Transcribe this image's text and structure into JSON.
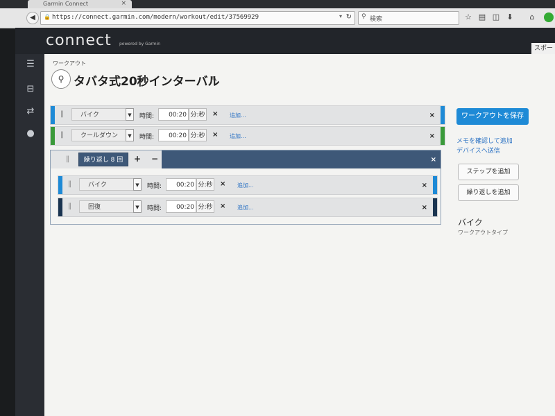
{
  "browser": {
    "tab_title": "Garmin Connect",
    "tab_close": "×",
    "url": "https://connect.garmin.com/modern/workout/edit/37569929",
    "search_placeholder": "検索",
    "toolbar_icons": [
      "star-icon",
      "clipboard-icon",
      "pocket-icon",
      "download-icon",
      "home-icon",
      "extension-icon"
    ]
  },
  "header": {
    "logo": "connect",
    "logo_sub": "powered by Garmin",
    "right_tab": "スポー"
  },
  "sidebar": {
    "icons": [
      "menu-icon",
      "inbox-icon",
      "link-icon",
      "person-icon"
    ]
  },
  "workout": {
    "breadcrumb": "ワークアウト",
    "title": "タバタ式20秒インターバル"
  },
  "steps": [
    {
      "type": "バイク",
      "time_label": "時間:",
      "time": "00:20",
      "unit": "分:秒",
      "add": "追加...",
      "color": "#1e8ad6"
    },
    {
      "type": "クールダウン",
      "time_label": "時間:",
      "time": "00:20",
      "unit": "分:秒",
      "add": "追加...",
      "color": "#3a9a3a"
    }
  ],
  "repeat": {
    "label": "繰り返し 8 回",
    "steps": [
      {
        "type": "バイク",
        "time_label": "時間:",
        "time": "00:20",
        "unit": "分:秒",
        "add": "追加...",
        "color": "#1e8ad6"
      },
      {
        "type": "回復",
        "time_label": "時間:",
        "time": "00:20",
        "unit": "分:秒",
        "add": "追加...",
        "color": "#1a3450"
      }
    ]
  },
  "actions": {
    "save": "ワークアウトを保存",
    "memo": "メモを確認して追加",
    "send": "デバイスへ送信",
    "add_step": "ステップを追加",
    "add_repeat": "繰り返しを追加"
  },
  "sport": {
    "type": "バイク",
    "caption": "ワークアウトタイプ"
  },
  "symbols": {
    "close": "×",
    "plus": "+",
    "minus": "−",
    "grip": "‖",
    "drop": "▼"
  }
}
